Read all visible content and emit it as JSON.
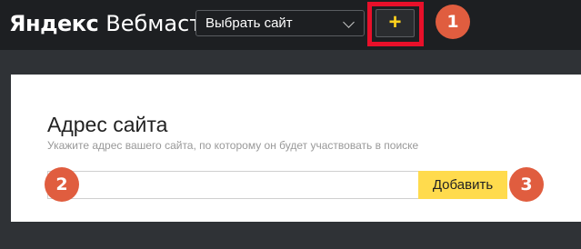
{
  "header": {
    "logo_brand": "Яндекс",
    "logo_product": "Вебмастер",
    "site_select": {
      "selected": "Выбрать сайт"
    },
    "add_button_label": "+"
  },
  "markers": [
    "1",
    "2",
    "3"
  ],
  "form": {
    "title": "Адрес сайта",
    "hint": "Укажите адрес вашего сайта, по которому он будет участвовать в поиске",
    "address_input": {
      "value": "",
      "placeholder": ""
    },
    "submit_label": "Добавить"
  },
  "colors": {
    "page_background": "#2f3236",
    "header_background": "#1d1f22",
    "accent_yellow": "#ffdb4d",
    "plus_color": "#ffd21e",
    "highlight_frame": "#e8102a",
    "marker_color": "#e05d3f"
  },
  "icons": {
    "dropdown": "chevron-down-icon",
    "add": "plus-icon"
  }
}
